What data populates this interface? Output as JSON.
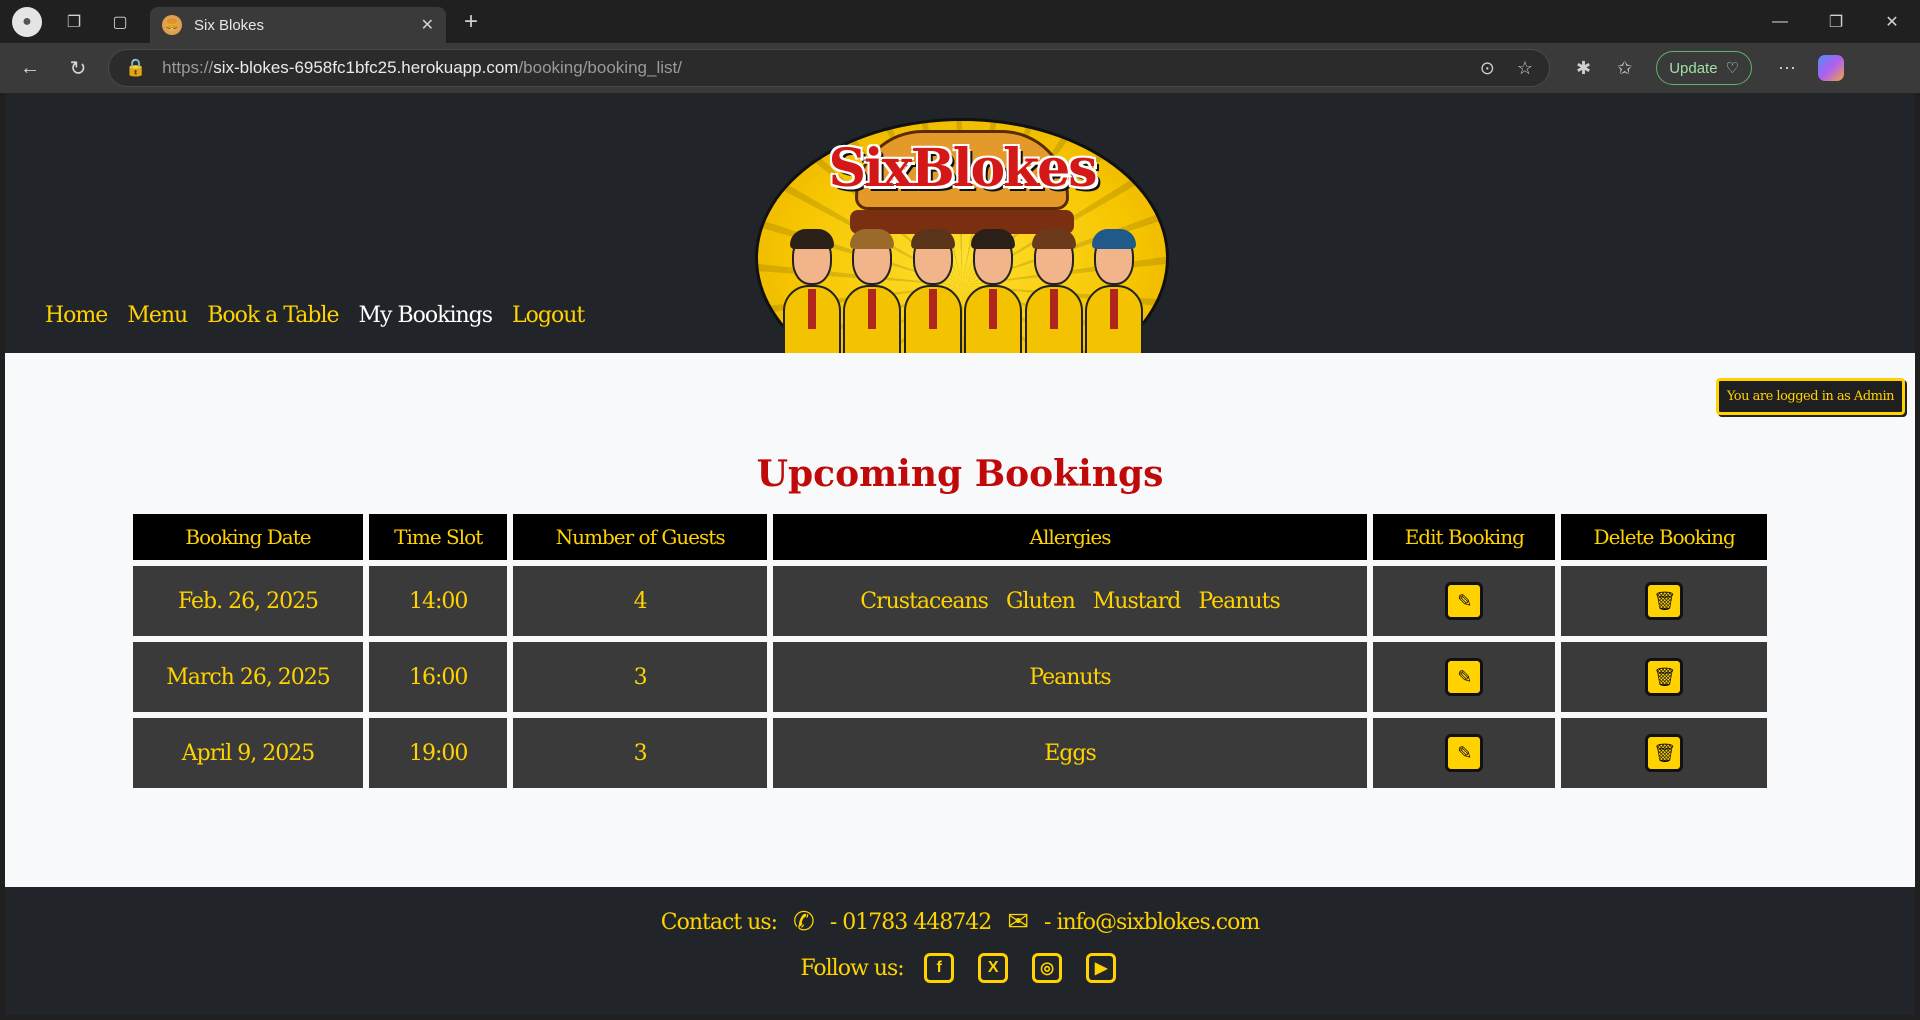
{
  "browser": {
    "tab_title": "Six Blokes",
    "url_scheme": "https://",
    "url_host": "six-blokes-6958fc1bfc25.herokuapp.com",
    "url_path": "/booking/booking_list/",
    "update_label": "Update"
  },
  "logo": {
    "text": "SixBlokes"
  },
  "nav": {
    "items": [
      {
        "label": "Home"
      },
      {
        "label": "Menu"
      },
      {
        "label": "Book a Table"
      },
      {
        "label": "My Bookings"
      },
      {
        "label": "Logout"
      }
    ]
  },
  "admin_badge": "You are logged in as Admin",
  "heading": "Upcoming Bookings",
  "table": {
    "headers": [
      "Booking Date",
      "Time Slot",
      "Number of Guests",
      "Allergies",
      "Edit Booking",
      "Delete Booking"
    ],
    "rows": [
      {
        "date": "Feb. 26, 2025",
        "time": "14:00",
        "guests": "4",
        "allergies": [
          "Crustaceans",
          "Gluten",
          "Mustard",
          "Peanuts"
        ]
      },
      {
        "date": "March 26, 2025",
        "time": "16:00",
        "guests": "3",
        "allergies": [
          "Peanuts"
        ]
      },
      {
        "date": "April 9, 2025",
        "time": "19:00",
        "guests": "3",
        "allergies": [
          "Eggs"
        ]
      }
    ]
  },
  "footer": {
    "contact_label": "Contact us:",
    "phone": "- 01783 448742",
    "email": "- info@sixblokes.com",
    "follow_label": "Follow us:",
    "social": [
      "facebook-icon",
      "x-icon",
      "instagram-icon",
      "youtube-icon"
    ]
  },
  "colors": {
    "accent": "#ffd200",
    "heading": "#c00a0a",
    "dark": "#212529"
  }
}
